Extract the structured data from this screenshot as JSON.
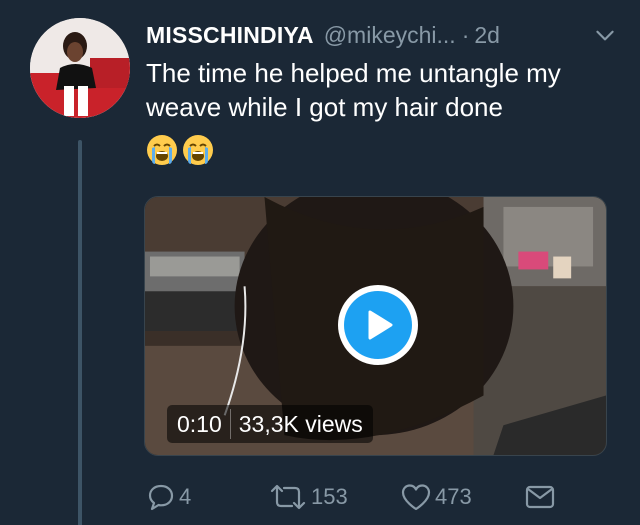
{
  "tweet": {
    "display_name": "MISSCHINDIYA",
    "handle": "@mikeychi...",
    "separator": "·",
    "time": "2d",
    "text": "The time he helped me untangle my weave while I got my hair done",
    "emojis": [
      "loudly-crying-face",
      "loudly-crying-face"
    ]
  },
  "media": {
    "duration": "0:10",
    "views": "33,3K views"
  },
  "actions": {
    "reply_count": "4",
    "retweet_count": "153",
    "like_count": "473"
  },
  "colors": {
    "background": "#1b2836",
    "secondary_text": "#8899a6",
    "accent": "#1da1f2",
    "thread_line": "#3d5466"
  },
  "icons": [
    "chevron-down-icon",
    "reply-icon",
    "retweet-icon",
    "heart-icon",
    "message-icon",
    "play-icon"
  ]
}
